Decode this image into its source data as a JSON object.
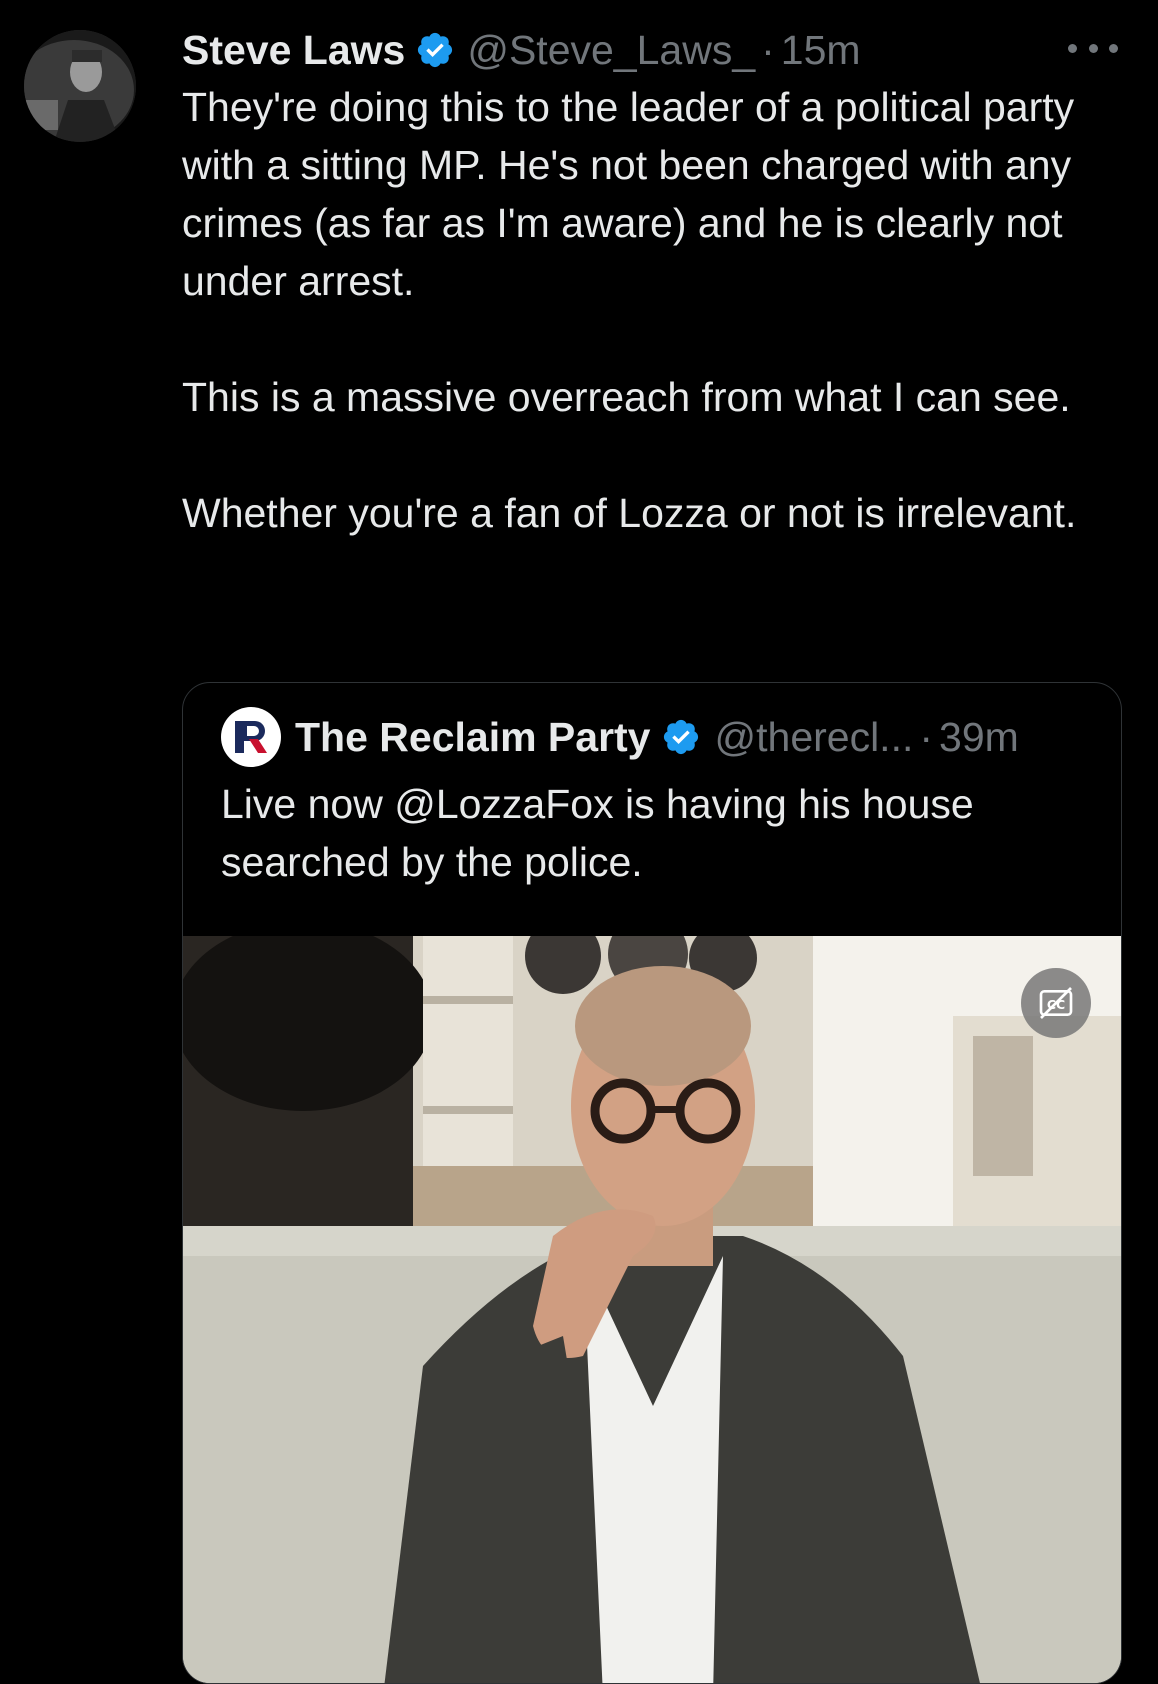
{
  "tweet": {
    "author_name": "Steve Laws",
    "handle": "@Steve_Laws_",
    "separator": "·",
    "time": "15m",
    "paragraphs": [
      "They're doing this to the leader of a political party with a sitting MP. He's not been charged with any crimes (as far as I'm aware) and he is clearly not under arrest.",
      "This is a massive overreach from what I can see.",
      "Whether you're a fan of Lozza or not is irrelevant."
    ]
  },
  "quoted_tweet": {
    "author_name": "The Reclaim Party",
    "handle": "@therecl...",
    "separator": "·",
    "time": "39m",
    "text": "Live now @LozzaFox is having his house searched by the police."
  },
  "colors": {
    "background": "#000000",
    "text_primary": "#e7e9ea",
    "text_secondary": "#71767b",
    "verified_blue": "#1d9bf0",
    "border": "#2f3336"
  },
  "icons": {
    "verified": "verified-badge-icon",
    "more": "more-options-icon",
    "captions": "captions-off-icon"
  }
}
